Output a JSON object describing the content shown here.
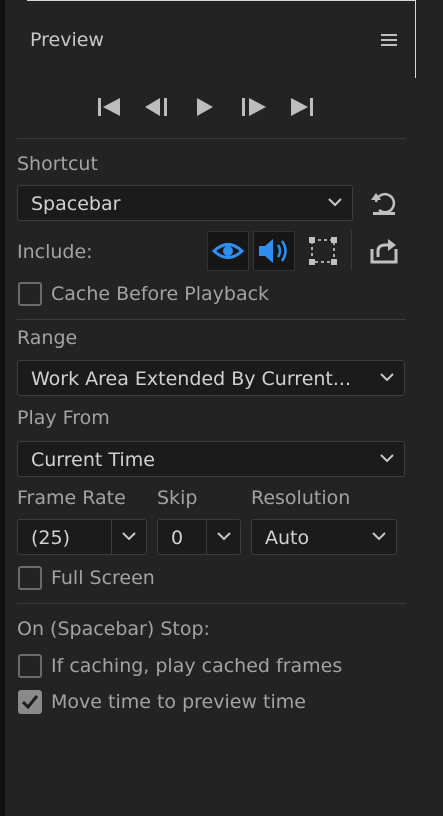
{
  "panel": {
    "title": "Preview"
  },
  "transport": {
    "buttons": [
      {
        "name": "go-to-start",
        "icon": "skip-to-start-icon"
      },
      {
        "name": "step-back",
        "icon": "step-back-icon"
      },
      {
        "name": "play",
        "icon": "play-icon"
      },
      {
        "name": "step-forward",
        "icon": "step-forward-icon"
      },
      {
        "name": "go-to-end",
        "icon": "skip-to-end-icon"
      }
    ]
  },
  "shortcut": {
    "label": "Shortcut",
    "value": "Spacebar"
  },
  "include": {
    "label": "Include:",
    "video_on": true,
    "audio_on": true,
    "overlays_on": false
  },
  "cache_before_playback": {
    "label": "Cache Before Playback",
    "checked": false
  },
  "range": {
    "label": "Range",
    "value": "Work Area Extended By Current..."
  },
  "play_from": {
    "label": "Play From",
    "value": "Current Time"
  },
  "frame_rate": {
    "label": "Frame Rate",
    "value": "(25)"
  },
  "skip": {
    "label": "Skip",
    "value": "0"
  },
  "resolution": {
    "label": "Resolution",
    "value": "Auto"
  },
  "full_screen": {
    "label": "Full Screen",
    "checked": false
  },
  "on_stop": {
    "label": "On (Spacebar) Stop:",
    "if_caching": {
      "label": "If caching, play cached frames",
      "checked": false
    },
    "move_time": {
      "label": "Move time to preview time",
      "checked": true
    }
  },
  "colors": {
    "accent": "#2f8ff0",
    "background": "#232323",
    "field": "#1b1b1b"
  }
}
